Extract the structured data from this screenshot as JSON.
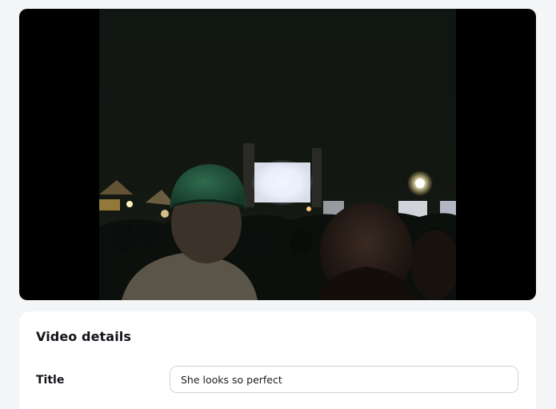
{
  "video": {
    "description": ""
  },
  "details": {
    "heading": "Video details",
    "title_label": "Title",
    "title_value": "She looks so perfect"
  },
  "colors": {
    "page_background": "#f4f5f7",
    "card_background": "#ffffff",
    "player_background": "#000000",
    "text_primary": "#111318",
    "input_border": "#cfd3da"
  }
}
